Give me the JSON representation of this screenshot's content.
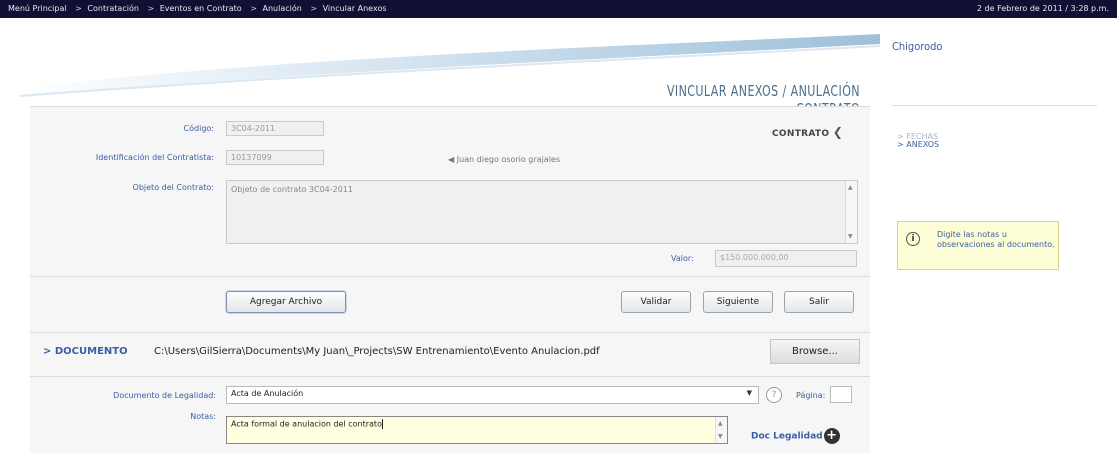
{
  "nav": {
    "breadcrumbs": [
      "Menú Principal",
      "Contratación",
      "Eventos en Contrato",
      "Anulación",
      "Vincular Anexos"
    ],
    "separator": ">",
    "datetime": "2 de Febrero de 2011 / 3:28 p.m."
  },
  "page": {
    "title": "VINCULAR ANEXOS / ANULACIÓN CONTRATO"
  },
  "form": {
    "codigo_label": "Código:",
    "codigo_value": "3C04-2011",
    "identificacion_label": "Identificación del Contratista:",
    "identificacion_value": "10137099",
    "contrato_header": "CONTRATO",
    "contratista_name": "Juan diego osorio grajales",
    "objeto_label": "Objeto del Contrato:",
    "objeto_value": "Objeto de contrato 3C04-2011",
    "valor_label": "Valor:",
    "valor_value": "$150.000.000,00"
  },
  "buttons": {
    "agregar": "Agregar Archivo",
    "validar": "Validar",
    "siguiente": "Siguiente",
    "salir": "Salir",
    "browse": "Browse..."
  },
  "documento": {
    "title": "> DOCUMENTO",
    "path": "C:\\Users\\GilSierra\\Documents\\My Juan\\_Projects\\SW Entrenamiento\\Evento Anulacion.pdf",
    "legalidad_label": "Documento de Legalidad:",
    "legalidad_value": "Acta de Anulación",
    "pagina_label": "Página:",
    "notas_label": "Notas:",
    "notas_value": "Acta formal de anulacion del contrato",
    "doc_legalidad_link": "Doc Legalidad"
  },
  "sidebar": {
    "user": "Chigorodo",
    "links": [
      "> FECHAS",
      "> ANEXOS"
    ],
    "tip": "Digite las notas u observaciones al documento."
  },
  "colors": {
    "topbar": "#0f1033",
    "accent": "#3a5fa3",
    "tip_bg": "#fefed6"
  }
}
